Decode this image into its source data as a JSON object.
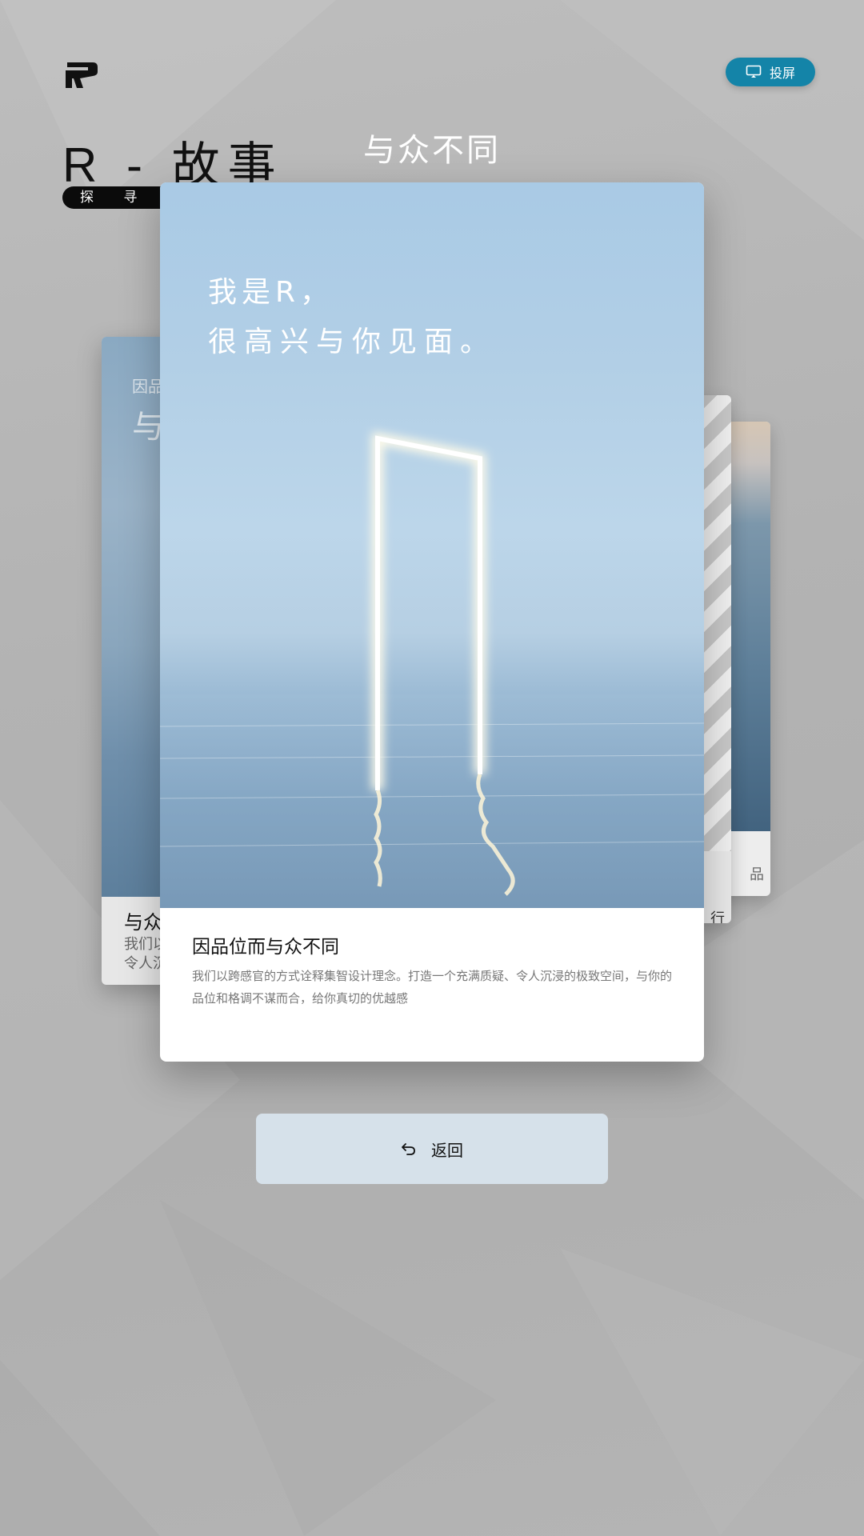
{
  "header": {
    "logo_icon": "brand-r-logo",
    "cast_button": {
      "label": "投屏",
      "icon": "cast-screen-icon",
      "color": "#1484a8"
    }
  },
  "page": {
    "title": "R - 故事",
    "subtitle": "探 寻 R",
    "section_heading": "与众不同"
  },
  "cards": {
    "left": {
      "image_category": "因品",
      "image_title": "与",
      "title": "与众",
      "desc_line1": "我们以",
      "desc_line2": "令人沉"
    },
    "right1": {
      "caption": "品"
    },
    "right2": {
      "caption": "行"
    },
    "main": {
      "hero_line1": "我是R，",
      "hero_line2": "很高兴与你见面。",
      "title": "因品位而与众不同",
      "description": "我们以跨感官的方式诠释集智设计理念。打造一个充满质疑、令人沉浸的极致空间，与你的品位和格调不谋而合，给你真切的优越感"
    }
  },
  "actions": {
    "back_label": "返回",
    "back_icon": "undo-arrow-icon"
  },
  "colors": {
    "accent": "#1484a8",
    "back_button_bg": "#d6e1ea",
    "background": "#b3b3b3"
  }
}
